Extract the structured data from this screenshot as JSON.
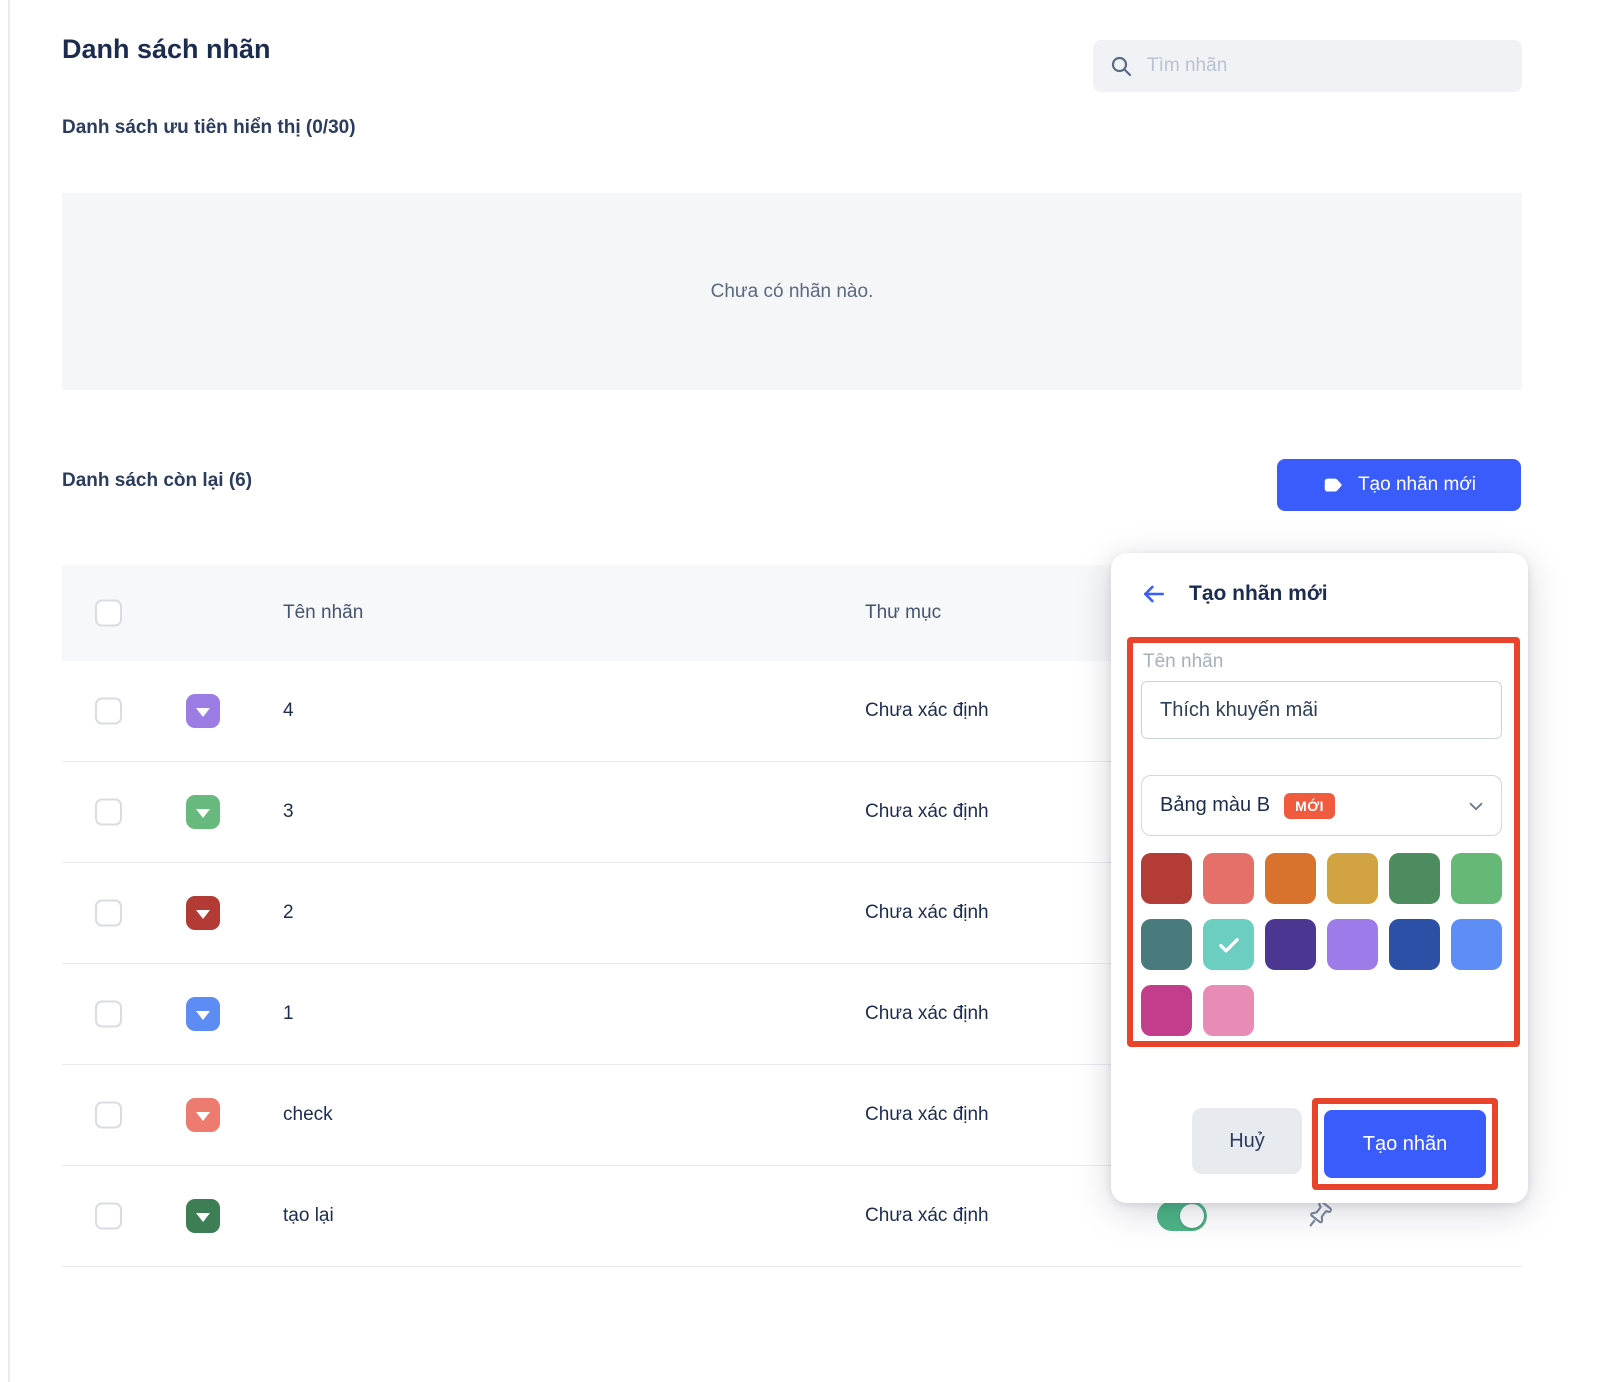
{
  "page": {
    "title": "Danh sách nhãn"
  },
  "search": {
    "placeholder": "Tìm nhãn"
  },
  "priority_section": {
    "label": "Danh sách ưu tiên hiển thị (0/30)",
    "empty_text": "Chưa có nhãn nào."
  },
  "remaining_section": {
    "label": "Danh sách còn lại (6)",
    "create_button_label": "Tạo nhãn mới"
  },
  "table": {
    "headers": {
      "name": "Tên nhãn",
      "folder": "Thư mục"
    },
    "rows": [
      {
        "name": "4",
        "tag_color": "#9b7ce5",
        "folder": "Chưa xác định"
      },
      {
        "name": "3",
        "tag_color": "#67b97d",
        "folder": "Chưa xác định"
      },
      {
        "name": "2",
        "tag_color": "#b23b35",
        "folder": "Chưa xác định"
      },
      {
        "name": "1",
        "tag_color": "#5c8cf4",
        "folder": "Chưa xác định"
      },
      {
        "name": "check",
        "tag_color": "#ee7b6f",
        "folder": "Chưa xác định"
      },
      {
        "name": "tạo lại",
        "tag_color": "#3d7e54",
        "folder": "Chưa xác định",
        "toggle_on": true,
        "pinned_icon": true
      }
    ]
  },
  "popup": {
    "title": "Tạo nhãn mới",
    "name_label": "Tên nhãn",
    "name_value": "Thích khuyến mãi",
    "palette_label": "Bảng màu B",
    "palette_badge": "MỚI",
    "swatches": [
      "#b43c36",
      "#e57069",
      "#d9722c",
      "#d1a441",
      "#4c8c5f",
      "#66b877",
      "#4a7b7c",
      "#6bcec0",
      "#4b3791",
      "#9d7ce9",
      "#2c50a6",
      "#5f8df6",
      "#c23e8c",
      "#e78cb5"
    ],
    "selected_swatch_index": 7,
    "cancel_label": "Huỷ",
    "submit_label": "Tạo nhãn"
  },
  "colors": {
    "accent_blue": "#3b5cfc",
    "highlight_red": "#e8432b",
    "badge_orange": "#f05a3d",
    "toggle_green": "#4db586"
  }
}
